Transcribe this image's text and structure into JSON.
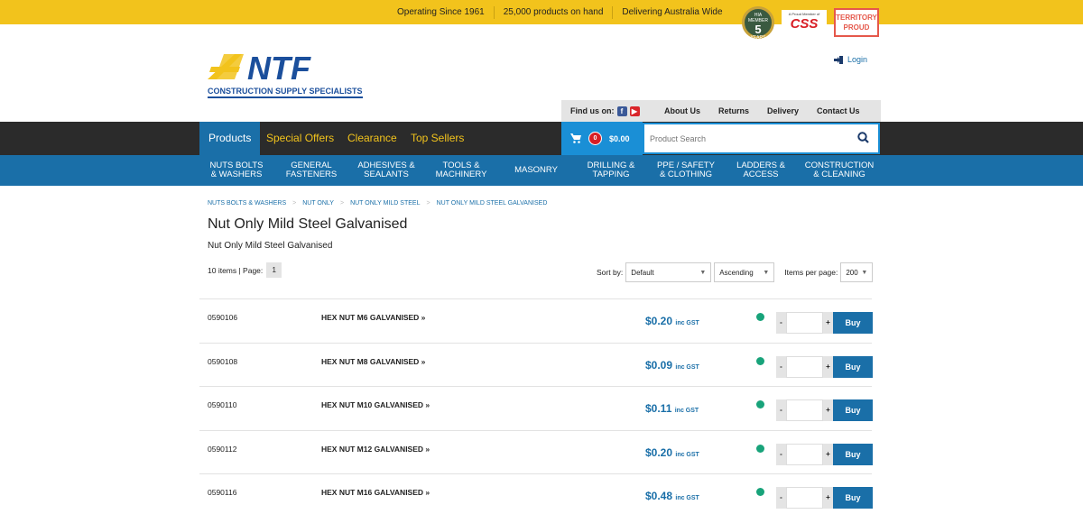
{
  "topbar": {
    "messages": [
      "Operating Since 1961",
      "25,000 products on hand",
      "Delivering Australia Wide"
    ],
    "badge_hia": {
      "top": "HIA MEMBER",
      "num": "5",
      "bottom": "YEARS"
    },
    "badge_css": {
      "small": "A Proud Member of",
      "big": "CSS"
    },
    "badge_territory": {
      "line1": "TERRITORY",
      "line2": "PROUD"
    }
  },
  "logo": {
    "brand": "NTF",
    "tagline": "CONSTRUCTION SUPPLY SPECIALISTS"
  },
  "login_label": "Login",
  "subnav": {
    "findus": "Find us on:",
    "links": [
      "About Us",
      "Returns",
      "Delivery",
      "Contact Us"
    ]
  },
  "mainnav": {
    "items": [
      "Products",
      "Special Offers",
      "Clearance",
      "Top Sellers"
    ]
  },
  "cart": {
    "count": "0",
    "total": "$0.00"
  },
  "search": {
    "placeholder": "Product Search"
  },
  "categories": [
    {
      "l1": "NUTS BOLTS",
      "l2": "& WASHERS"
    },
    {
      "l1": "GENERAL",
      "l2": "FASTENERS"
    },
    {
      "l1": "ADHESIVES &",
      "l2": "SEALANTS"
    },
    {
      "l1": "TOOLS &",
      "l2": "MACHINERY"
    },
    {
      "l1": "MASONRY",
      "l2": ""
    },
    {
      "l1": "DRILLING &",
      "l2": "TAPPING"
    },
    {
      "l1": "PPE / SAFETY",
      "l2": "& CLOTHING"
    },
    {
      "l1": "LADDERS &",
      "l2": "ACCESS"
    },
    {
      "l1": "CONSTRUCTION",
      "l2": "& CLEANING"
    }
  ],
  "breadcrumb": [
    "NUTS BOLTS & WASHERS",
    "NUT ONLY",
    "NUT ONLY MILD STEEL",
    "NUT ONLY MILD STEEL GALVANISED"
  ],
  "page": {
    "title": "Nut Only Mild Steel Galvanised",
    "subtitle": "Nut Only Mild Steel Galvanised",
    "count_label": "10 items | Page:",
    "page_num": "1"
  },
  "sort": {
    "sortby_label": "Sort by:",
    "sortby_value": "Default",
    "order_value": "Ascending",
    "perpage_label": "Items per page:",
    "perpage_value": "200"
  },
  "products": [
    {
      "code": "0590106",
      "name": "HEX NUT M6 GALVANISED »",
      "price": "$0.20",
      "gst": "inc GST"
    },
    {
      "code": "0590108",
      "name": "HEX NUT M8 GALVANISED »",
      "price": "$0.09",
      "gst": "inc GST"
    },
    {
      "code": "0590110",
      "name": "HEX NUT M10 GALVANISED »",
      "price": "$0.11",
      "gst": "inc GST"
    },
    {
      "code": "0590112",
      "name": "HEX NUT M12 GALVANISED »",
      "price": "$0.20",
      "gst": "inc GST"
    },
    {
      "code": "0590116",
      "name": "HEX NUT M16 GALVANISED »",
      "price": "$0.48",
      "gst": "inc GST"
    }
  ],
  "row_controls": {
    "minus": "-",
    "plus": "+",
    "buy": "Buy"
  },
  "colors": {
    "accent_blue": "#1a6fa8",
    "brand_yellow": "#f2c31c",
    "dark": "#2b2b2b",
    "stock_green": "#18a37a"
  }
}
